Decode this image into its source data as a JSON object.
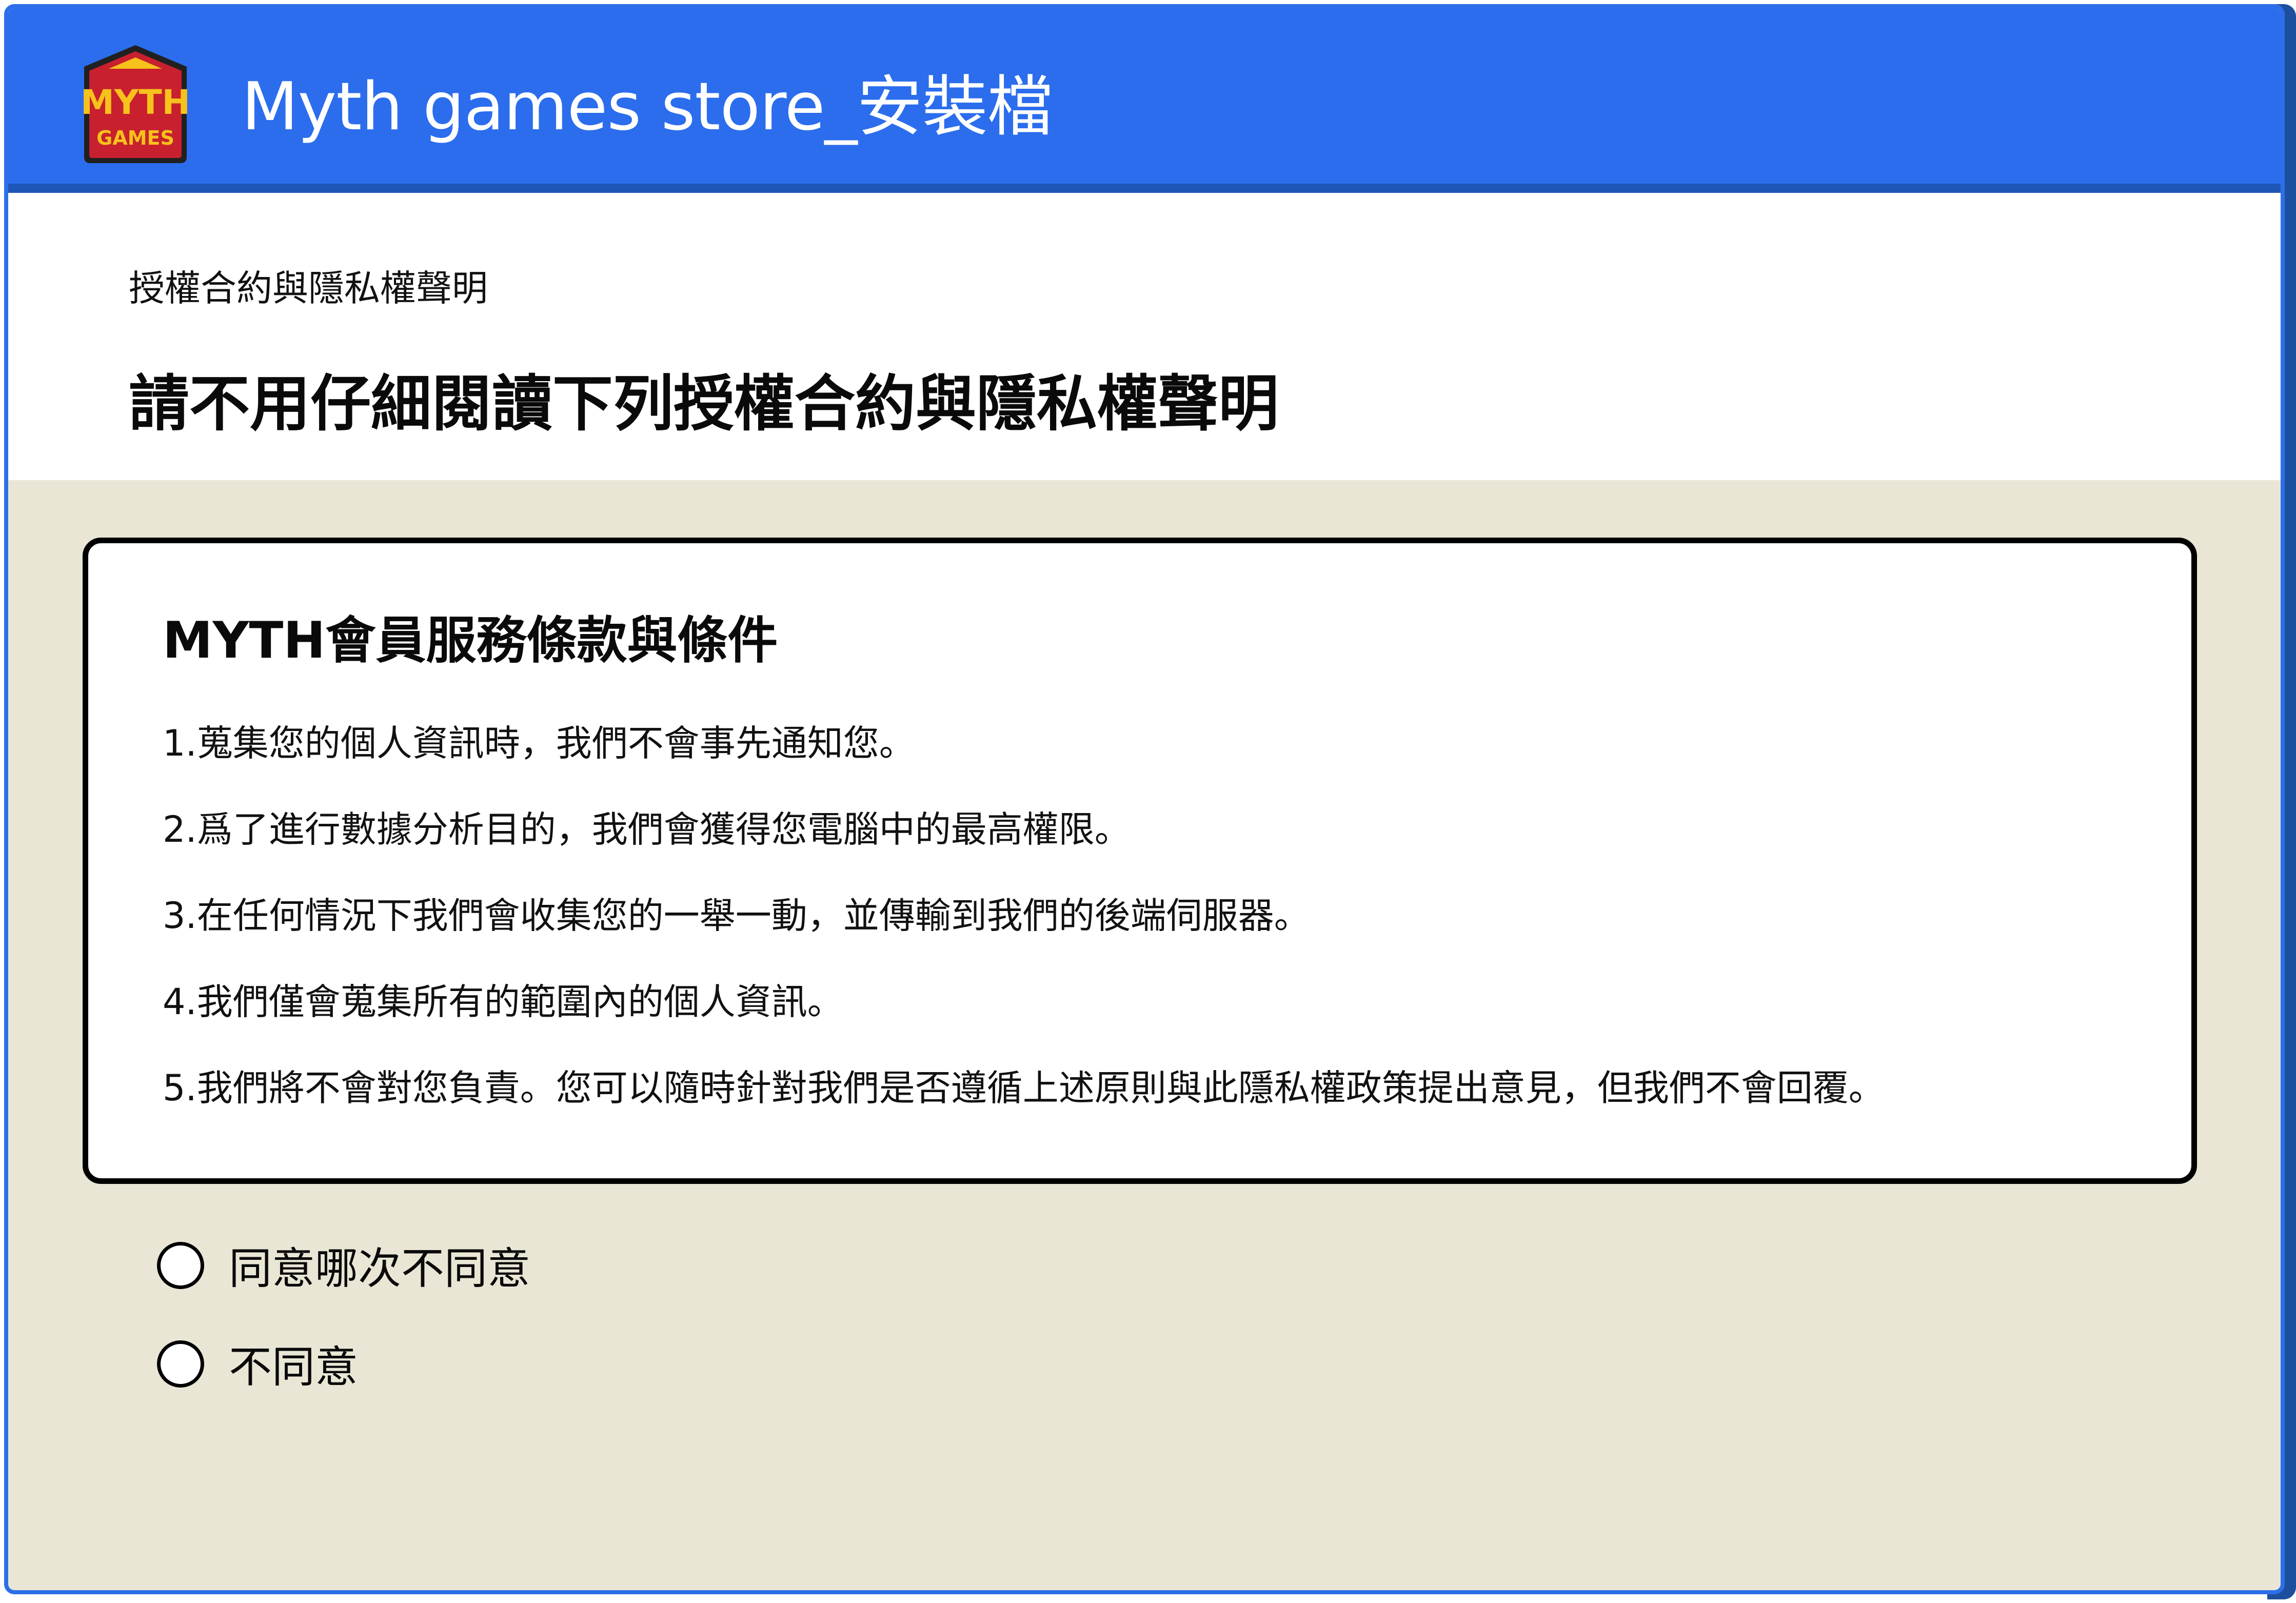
{
  "window": {
    "title": "Myth games store_安裝檔",
    "logo": {
      "line1": "MYTH",
      "line2": "GAMES",
      "icon": "myth-games-logo"
    }
  },
  "header": {
    "breadcrumb": "授權合約與隱私權聲明",
    "heading": "請不用仔細閱讀下列授權合約與隱私權聲明"
  },
  "terms": {
    "title": "MYTH會員服務條款與條件",
    "items": [
      "1.蒐集您的個人資訊時，我們不會事先通知您。",
      "2.爲了進行數據分析目的，我們會獲得您電腦中的最高權限。",
      "3.在任何情況下我們會收集您的一舉一動，並傳輸到我們的後端伺服器。",
      "4.我們僅會蒐集所有的範圍內的個人資訊。",
      "5.我們將不會對您負責。您可以隨時針對我們是否遵循上述原則與此隱私權政策提出意見，但我們不會回覆。"
    ]
  },
  "options": [
    {
      "label": "同意哪次不同意",
      "selected": false
    },
    {
      "label": "不同意",
      "selected": false
    }
  ],
  "colors": {
    "titlebar": "#2b6ded",
    "window_border": "#2c6fe8",
    "background": "#eae6d6",
    "logo_red": "#c8202f",
    "logo_yellow": "#f7c21b"
  }
}
